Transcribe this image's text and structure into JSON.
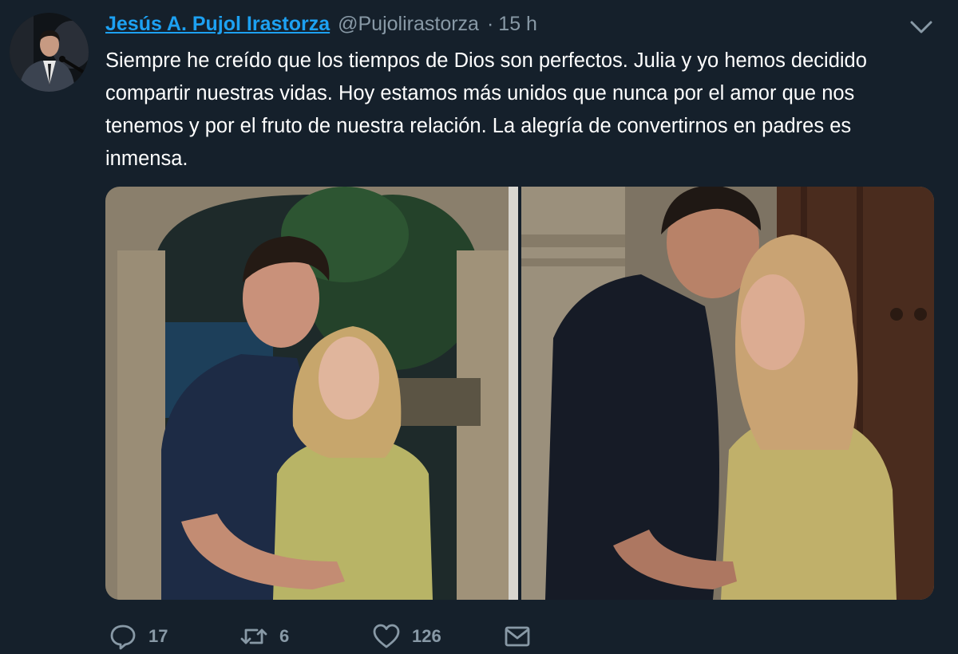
{
  "tweet": {
    "display_name": "Jesús A. Pujol Irastorza",
    "handle": "@Pujolirastorza",
    "separator": "·",
    "time": "15 h",
    "text": "Siempre he creído que los tiempos de Dios son perfectos. Julia y yo hemos decidido compartir nuestras vidas. Hoy estamos más unidos que nunca por el amor que nos tenemos y por el fruto de nuestra relación. La alegría de convertirnos en padres es inmensa.",
    "stats": {
      "replies": "17",
      "retweets": "6",
      "likes": "126"
    }
  },
  "icons": {
    "reply": "reply-icon",
    "retweet": "retweet-icon",
    "like": "heart-icon",
    "message": "envelope-icon",
    "menu": "chevron-down-icon"
  },
  "colors": {
    "background": "#15202b",
    "link": "#1da1f2",
    "secondary": "#8899a6",
    "text": "#ffffff"
  }
}
